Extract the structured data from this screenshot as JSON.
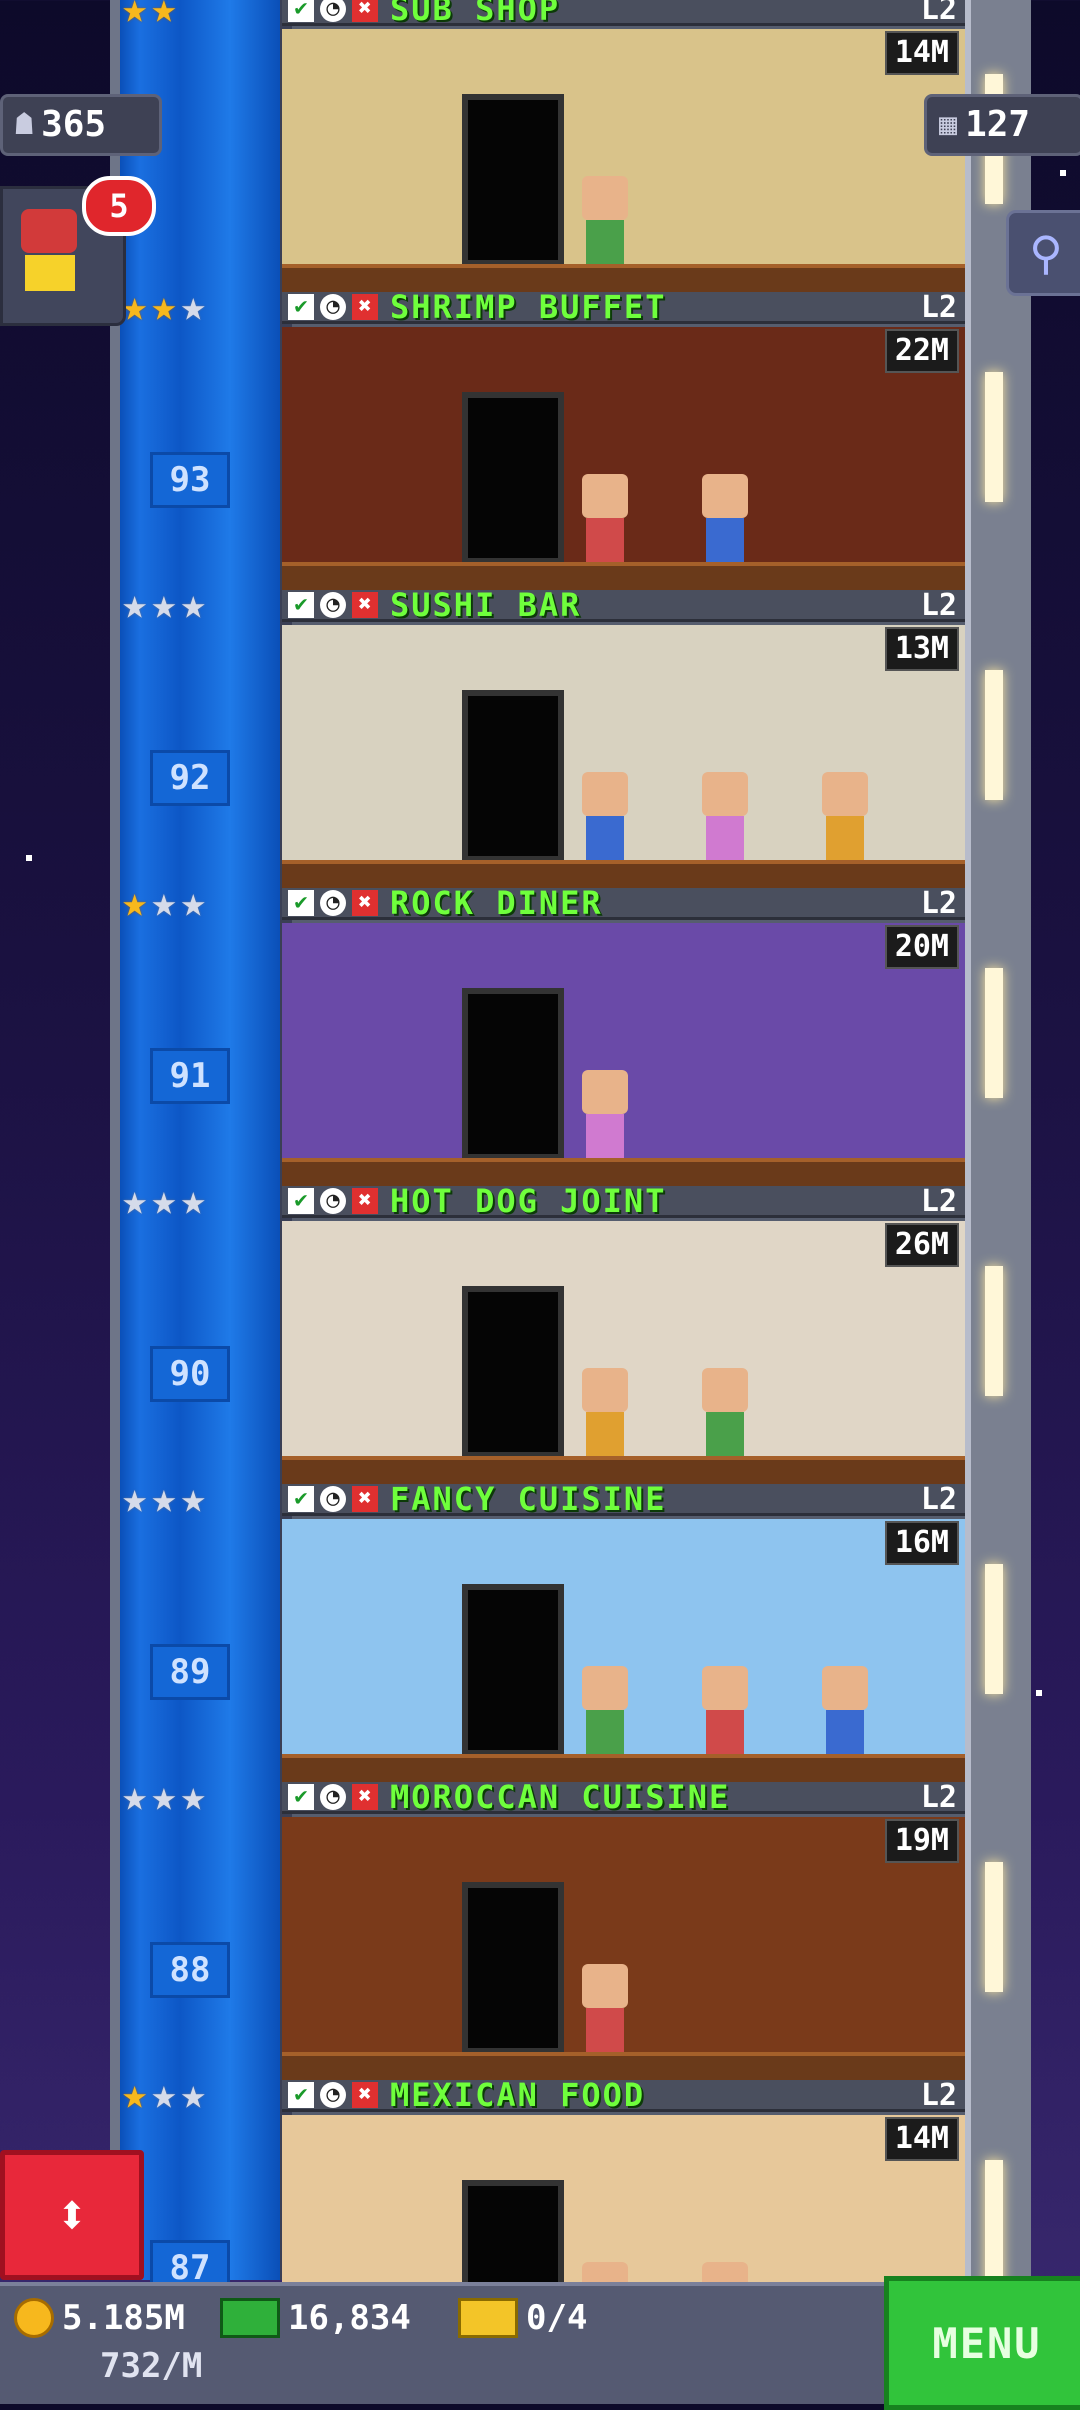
{
  "top_left": {
    "population": "365",
    "notification_count": "5"
  },
  "top_right": {
    "floors": "127"
  },
  "floors": [
    {
      "number": "",
      "name": "SUB SHOP",
      "level": "L2",
      "income": "14M",
      "stars": [
        "gold",
        "gold"
      ],
      "wall": "#d9c38a"
    },
    {
      "number": "93",
      "name": "SHRIMP BUFFET",
      "level": "L2",
      "income": "22M",
      "stars": [
        "gold",
        "gold",
        "silver"
      ],
      "wall": "#6a2a18"
    },
    {
      "number": "92",
      "name": "SUSHI BAR",
      "level": "L2",
      "income": "13M",
      "stars": [
        "silver",
        "silver",
        "silver"
      ],
      "wall": "#d8d2c0"
    },
    {
      "number": "91",
      "name": "ROCK DINER",
      "level": "L2",
      "income": "20M",
      "stars": [
        "gold",
        "silver",
        "silver"
      ],
      "wall": "#6a4aa8"
    },
    {
      "number": "90",
      "name": "HOT DOG JOINT",
      "level": "L2",
      "income": "26M",
      "stars": [
        "silver",
        "silver",
        "silver"
      ],
      "wall": "#e0d6c6"
    },
    {
      "number": "89",
      "name": "FANCY CUISINE",
      "level": "L2",
      "income": "16M",
      "stars": [
        "silver",
        "silver",
        "silver"
      ],
      "wall": "#8ec4ef"
    },
    {
      "number": "88",
      "name": "MOROCCAN CUISINE",
      "level": "L2",
      "income": "19M",
      "stars": [
        "silver",
        "silver",
        "silver"
      ],
      "wall": "#7a3a1a"
    },
    {
      "number": "87",
      "name": "MEXICAN FOOD",
      "level": "L2",
      "income": "14M",
      "stars": [
        "gold",
        "silver",
        "silver"
      ],
      "wall": "#e7c89a"
    }
  ],
  "bottom_bar": {
    "coins": "5.185M",
    "coins_rate": "732/M",
    "bux": "16,834",
    "tickets": "0/4",
    "menu_label": "MENU"
  },
  "colors": {
    "floor_name": "#6fff3c",
    "elevator": "#1a6fe0",
    "menu": "#31c43b",
    "alert": "#e0262c"
  },
  "icons": [
    "person-icon",
    "floors-icon",
    "search-icon",
    "check-icon",
    "clock-icon",
    "close-icon",
    "star-icon",
    "coin-icon",
    "bux-icon",
    "ticket-icon",
    "elevator-arrows-icon"
  ]
}
